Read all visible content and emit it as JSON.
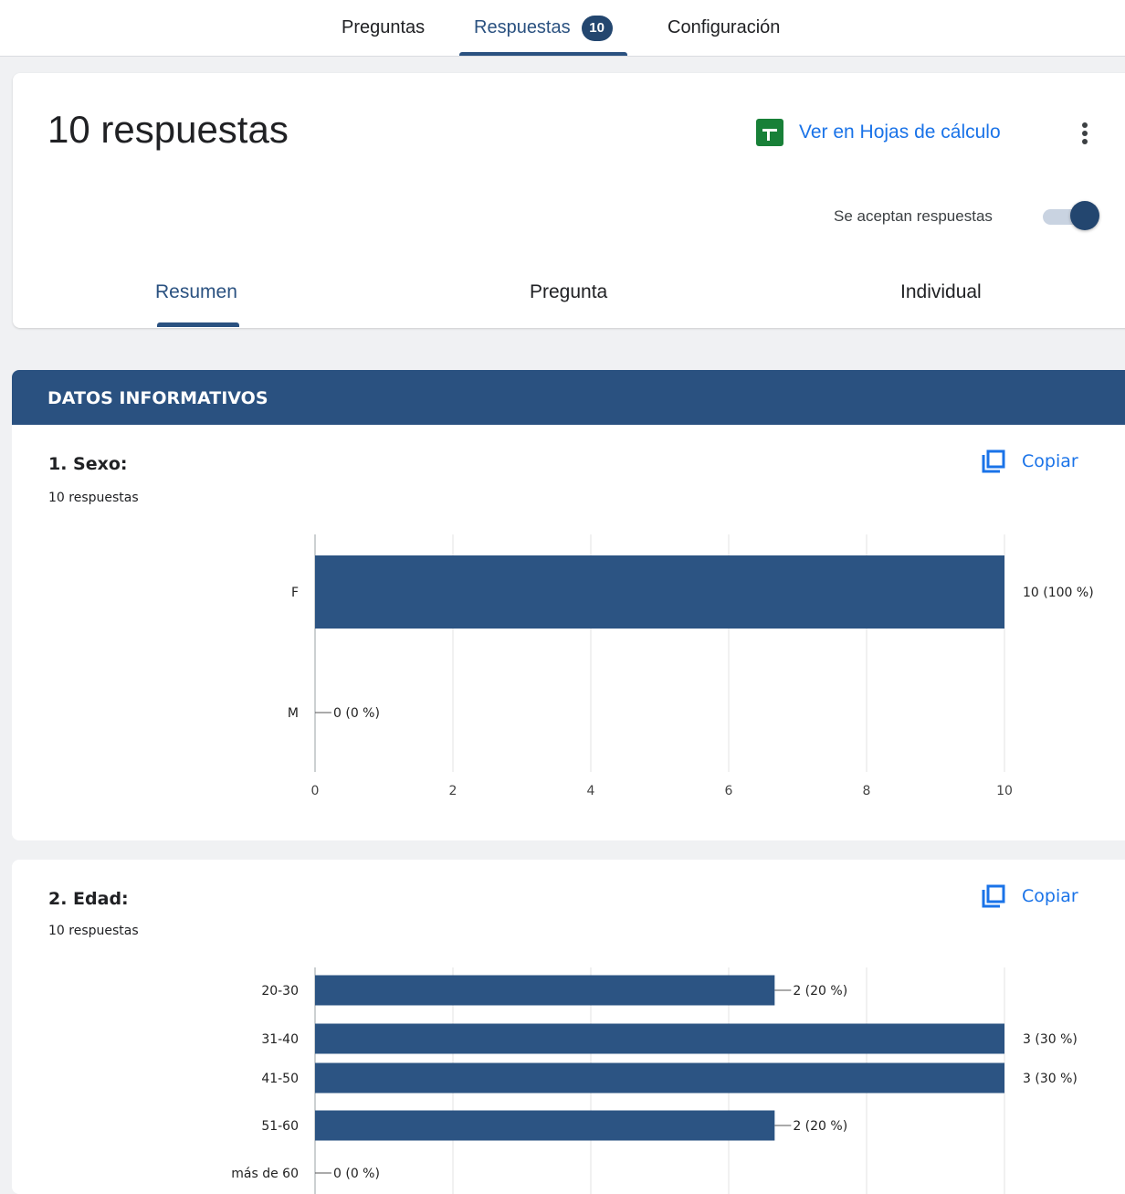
{
  "topnav": {
    "tabs": [
      {
        "label": "Preguntas"
      },
      {
        "label": "Respuestas",
        "badge": "10"
      },
      {
        "label": "Configuración"
      }
    ]
  },
  "summary": {
    "title": "10 respuestas",
    "sheets_link": "Ver en Hojas de cálculo",
    "accepting_label": "Se aceptan respuestas",
    "accepting": true,
    "subtabs": [
      "Resumen",
      "Pregunta",
      "Individual"
    ],
    "active_subtab": "Resumen"
  },
  "section": {
    "title": "DATOS INFORMATIVOS"
  },
  "questions": [
    {
      "title": "1. Sexo:",
      "count": "10 respuestas",
      "copy_label": "Copiar"
    },
    {
      "title": "2. Edad:",
      "count": "10 respuestas",
      "copy_label": "Copiar"
    }
  ],
  "colors": {
    "accent": "#2a5180",
    "bar": "#2c5483",
    "link": "#1a73e8",
    "sheets_green": "#188038"
  },
  "icons": [
    "sheets-icon",
    "more-vert-icon",
    "copy-icon"
  ],
  "chart_data": [
    {
      "type": "bar",
      "orientation": "horizontal",
      "categories": [
        "F",
        "M"
      ],
      "values": [
        10,
        0
      ],
      "data_labels": [
        "10 (100 %)",
        "0 (0 %)"
      ],
      "xlim": [
        0,
        10
      ],
      "xticks": [
        "0",
        "2",
        "4",
        "6",
        "8",
        "10"
      ],
      "grid": true
    },
    {
      "type": "bar",
      "orientation": "horizontal",
      "categories": [
        "20-30",
        "31-40",
        "41-50",
        "51-60",
        "más de 60"
      ],
      "values": [
        2,
        3,
        3,
        2,
        0
      ],
      "data_labels": [
        "2 (20 %)",
        "3 (30 %)",
        "3 (30 %)",
        "2 (20 %)",
        "0 (0 %)"
      ],
      "xlim": [
        0,
        3
      ],
      "grid": true
    }
  ]
}
